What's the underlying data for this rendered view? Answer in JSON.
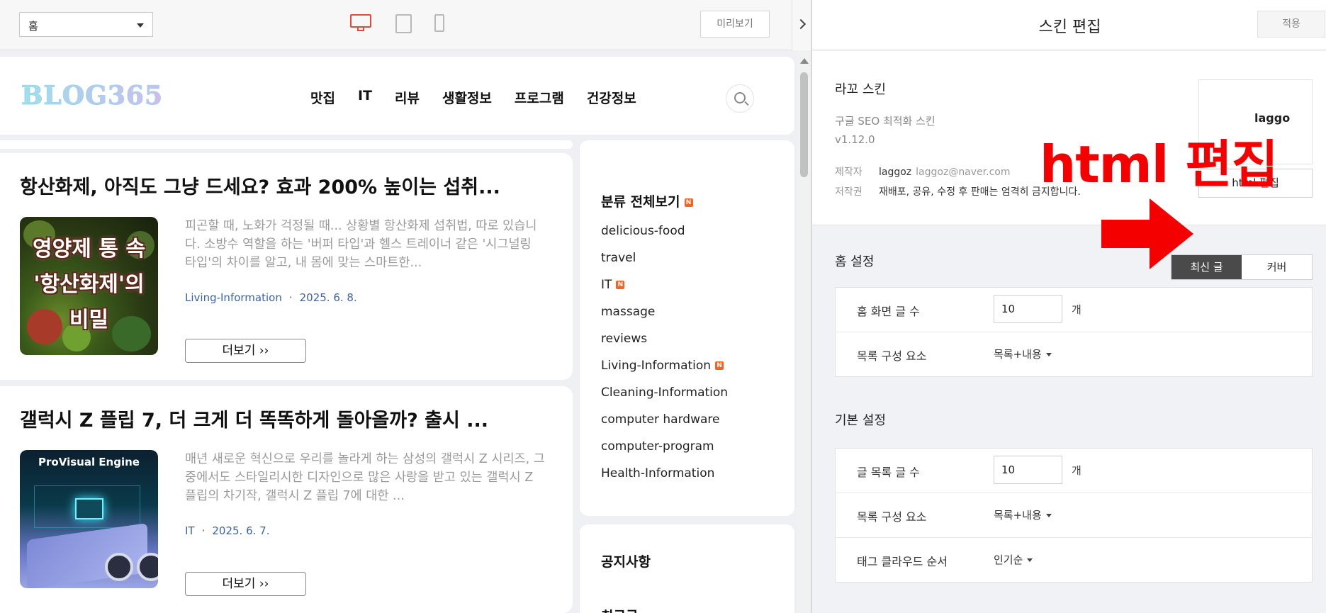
{
  "toolbar": {
    "page_select": "홈",
    "preview_label": "미리보기"
  },
  "blog": {
    "logo": "BLOG365",
    "nav": [
      "맛집",
      "IT",
      "리뷰",
      "생활정보",
      "프로그램",
      "건강정보"
    ],
    "posts": [
      {
        "title": "항산화제, 아직도 그냥 드세요? 효과 200% 높이는 섭취...",
        "excerpt": "피곤할 때, 노화가 걱정될 때... 상황별 항산화제 섭취법, 따로 있습니다. 소방수 역할을 하는 '버퍼 타입'과 헬스 트레이너 같은 '시그널링 타입'의 차이를 알고, 내 몸에 맞는 스마트한...",
        "category": "Living-Information",
        "date": "2025. 6. 8.",
        "more": "더보기 ››",
        "thumb_lines": [
          "영양제 통 속",
          "'항산화제'의",
          "비밀"
        ]
      },
      {
        "title": "갤럭시 Z 플립 7, 더 크게 더 똑똑하게 돌아올까? 출시 ...",
        "excerpt": "매년 새로운 혁신으로 우리를 놀라게 하는 삼성의 갤럭시 Z 시리즈, 그중에서도 스타일리시한 디자인으로 많은 사랑을 받고 있는 갤럭시 Z 플립의 차기작, 갤럭시 Z 플립 7에 대한 ...",
        "category": "IT",
        "date": "2025. 6. 7.",
        "more": "더보기 ››",
        "thumb_label": "ProVisual Engine"
      }
    ],
    "sidebar": {
      "category_title": "분류 전체보기",
      "new_badge": "N",
      "categories": [
        {
          "label": "delicious-food",
          "new": false
        },
        {
          "label": "travel",
          "new": false
        },
        {
          "label": "IT",
          "new": true
        },
        {
          "label": "massage",
          "new": false
        },
        {
          "label": "reviews",
          "new": false
        },
        {
          "label": "Living-Information",
          "new": true
        },
        {
          "label": "Cleaning-Information",
          "new": false
        },
        {
          "label": "computer hardware",
          "new": false
        },
        {
          "label": "computer-program",
          "new": false
        },
        {
          "label": "Health-Information",
          "new": false
        }
      ],
      "notice_title": "공지사항",
      "next_title": "최근글"
    }
  },
  "editor": {
    "title": "스킨 편집",
    "apply_label": "적용",
    "skin": {
      "name": "라꼬 스킨",
      "description": "구글 SEO 최적화 스킨",
      "version": "v1.12.0",
      "maker_label": "제작자",
      "maker_name": "laggoz",
      "maker_email": "laggoz@naver.com",
      "copyright_label": "저작권",
      "copyright_text": "재배포, 공유, 수정 후 판매는 엄격히 금지합니다.",
      "thumb_text": "laggo",
      "html_edit_label": "html 편집"
    },
    "annotation": {
      "text": "html 편집",
      "color": "#f40000"
    },
    "home": {
      "title": "홈 설정",
      "tabs": [
        "최신 글",
        "커버"
      ],
      "rows": {
        "count_label": "홈 화면 글 수",
        "count_value": "10",
        "unit": "개",
        "layout_label": "목록 구성 요소",
        "layout_value": "목록+내용"
      }
    },
    "basic": {
      "title": "기본 설정",
      "rows": {
        "count_label": "글 목록 글 수",
        "count_value": "10",
        "unit": "개",
        "layout_label": "목록 구성 요소",
        "layout_value": "목록+내용",
        "tag_label": "태그 클라우드 순서",
        "tag_value": "인기순"
      }
    }
  }
}
